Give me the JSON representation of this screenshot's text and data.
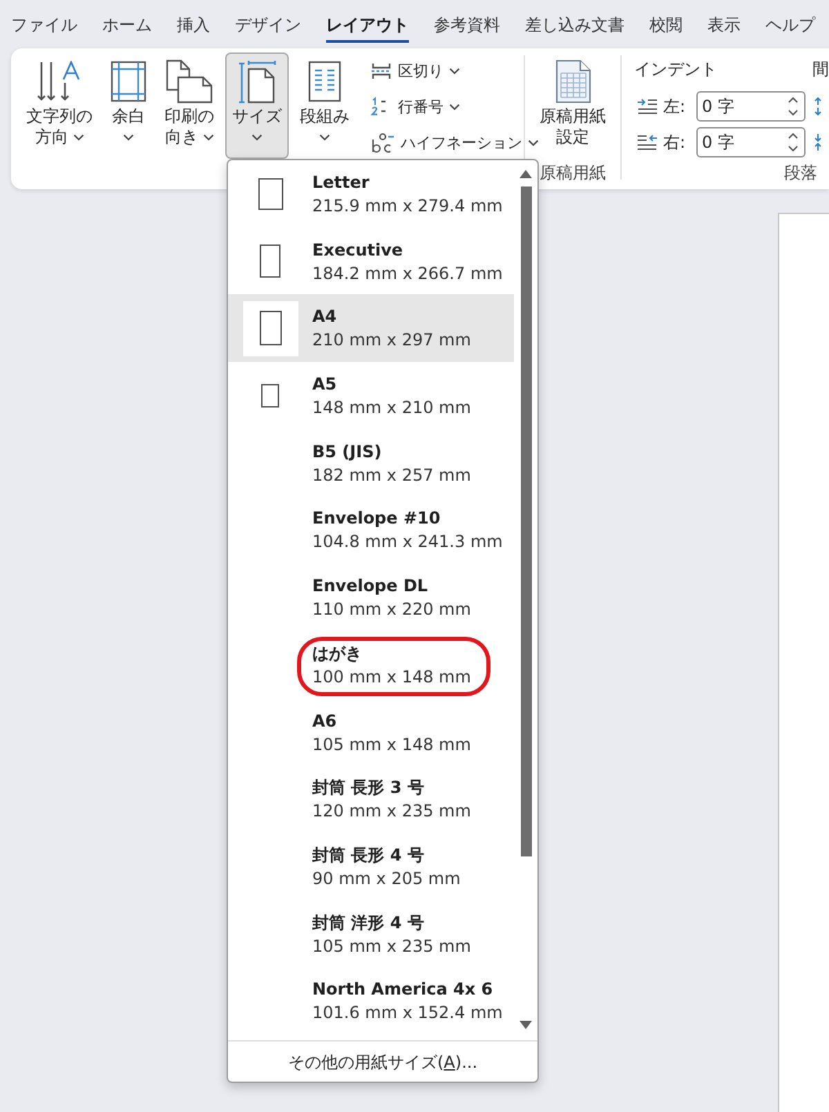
{
  "menu_tabs": [
    {
      "label": "ファイル",
      "selected": false
    },
    {
      "label": "ホーム",
      "selected": false
    },
    {
      "label": "挿入",
      "selected": false
    },
    {
      "label": "デザイン",
      "selected": false
    },
    {
      "label": "レイアウト",
      "selected": true
    },
    {
      "label": "参考資料",
      "selected": false
    },
    {
      "label": "差し込み文書",
      "selected": false
    },
    {
      "label": "校閲",
      "selected": false
    },
    {
      "label": "表示",
      "selected": false
    },
    {
      "label": "ヘルプ",
      "selected": false
    }
  ],
  "ribbon": {
    "page_setup": {
      "large_buttons": [
        {
          "label_lines": [
            "文字列の",
            "方向"
          ],
          "dropdown": true,
          "selected": false
        },
        {
          "label_lines": [
            "余白"
          ],
          "dropdown": true,
          "selected": false
        },
        {
          "label_lines": [
            "印刷の",
            "向き"
          ],
          "dropdown": true,
          "selected": false
        },
        {
          "label_lines": [
            "サイズ"
          ],
          "dropdown": true,
          "selected": true
        },
        {
          "label_lines": [
            "段組み"
          ],
          "dropdown": true,
          "selected": false
        }
      ],
      "small_buttons": [
        {
          "label": "区切り",
          "dropdown": true
        },
        {
          "label": "行番号",
          "dropdown": true
        },
        {
          "label": "ハイフネーション",
          "dropdown": true
        }
      ]
    },
    "manuscript": {
      "button_lines": [
        "原稿用紙",
        "設定"
      ],
      "group_label": "原稿用紙"
    },
    "paragraph": {
      "indent_label": "インデント",
      "indent_fields": [
        {
          "label": "左:",
          "value": "0 字"
        },
        {
          "label": "右:",
          "value": "0 字"
        }
      ],
      "spacing_label": "間",
      "group_label": "段落"
    }
  },
  "size_menu": {
    "items": [
      {
        "name": "Letter",
        "dimensions": "215.9 mm x 279.4 mm",
        "kind": "with-icon",
        "selected": false,
        "circled": false
      },
      {
        "name": "Executive",
        "dimensions": "184.2 mm x 266.7 mm",
        "kind": "with-icon",
        "selected": false,
        "circled": false
      },
      {
        "name": "A4",
        "dimensions": "210 mm x 297 mm",
        "kind": "with-icon",
        "selected": true,
        "circled": false
      },
      {
        "name": "A5",
        "dimensions": "148 mm x 210 mm",
        "kind": "with-icon",
        "selected": false,
        "circled": false
      },
      {
        "name": "B5 (JIS)",
        "dimensions": "182 mm x 257 mm",
        "kind": "text-only",
        "selected": false,
        "circled": false
      },
      {
        "name": "Envelope #10",
        "dimensions": "104.8 mm x 241.3 mm",
        "kind": "text-only",
        "selected": false,
        "circled": false
      },
      {
        "name": "Envelope DL",
        "dimensions": "110 mm x 220 mm",
        "kind": "text-only",
        "selected": false,
        "circled": false
      },
      {
        "name": "はがき",
        "dimensions": "100 mm x 148 mm",
        "kind": "text-only",
        "selected": false,
        "circled": true
      },
      {
        "name": "A6",
        "dimensions": "105 mm x 148 mm",
        "kind": "text-only",
        "selected": false,
        "circled": false
      },
      {
        "name": "封筒 長形 3 号",
        "dimensions": "120 mm x 235 mm",
        "kind": "text-only",
        "selected": false,
        "circled": false
      },
      {
        "name": "封筒 長形 4 号",
        "dimensions": "90 mm x 205 mm",
        "kind": "text-only",
        "selected": false,
        "circled": false
      },
      {
        "name": "封筒 洋形 4 号",
        "dimensions": "105 mm x 235 mm",
        "kind": "text-only",
        "selected": false,
        "circled": false
      },
      {
        "name": "North America 4x 6",
        "dimensions": "101.6 mm x 152.4 mm",
        "kind": "text-only",
        "selected": false,
        "circled": false
      }
    ],
    "more_sizes": {
      "before": "その他の用紙サイズ(",
      "access_key": "A",
      "after": ")..."
    }
  }
}
